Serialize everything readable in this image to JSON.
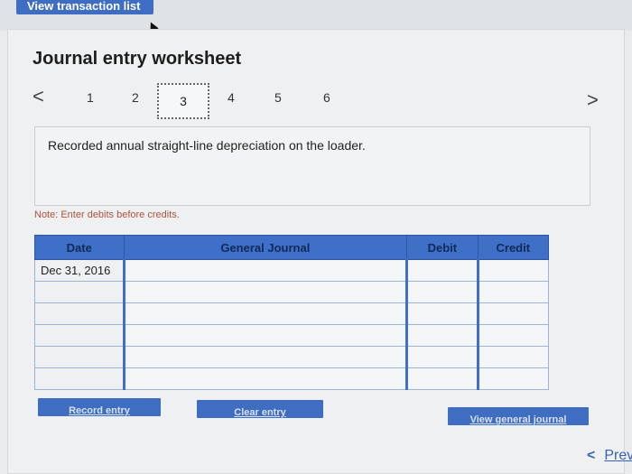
{
  "top_bar": {
    "button_label": "View transaction list"
  },
  "worksheet": {
    "title": "Journal entry worksheet",
    "pager": {
      "prev_label": "<",
      "next_label": ">",
      "pages": [
        "1",
        "2",
        "3",
        "4",
        "5",
        "6"
      ],
      "active_page": "3"
    },
    "description": "Recorded annual straight-line depreciation on the loader.",
    "note": "Note: Enter debits before credits."
  },
  "journal_table": {
    "headers": {
      "date": "Date",
      "general_journal": "General Journal",
      "debit": "Debit",
      "credit": "Credit"
    },
    "rows": [
      {
        "date": "Dec 31, 2016",
        "account": "",
        "debit": "",
        "credit": ""
      },
      {
        "date": "",
        "account": "",
        "debit": "",
        "credit": ""
      },
      {
        "date": "",
        "account": "",
        "debit": "",
        "credit": ""
      },
      {
        "date": "",
        "account": "",
        "debit": "",
        "credit": ""
      },
      {
        "date": "",
        "account": "",
        "debit": "",
        "credit": ""
      },
      {
        "date": "",
        "account": "",
        "debit": "",
        "credit": ""
      }
    ]
  },
  "actions": {
    "record_entry": "Record entry",
    "clear_entry": "Clear entry",
    "view_general_journal": "View general journal"
  },
  "footer": {
    "prev_chevron": "<",
    "prev_label": "Prev"
  }
}
